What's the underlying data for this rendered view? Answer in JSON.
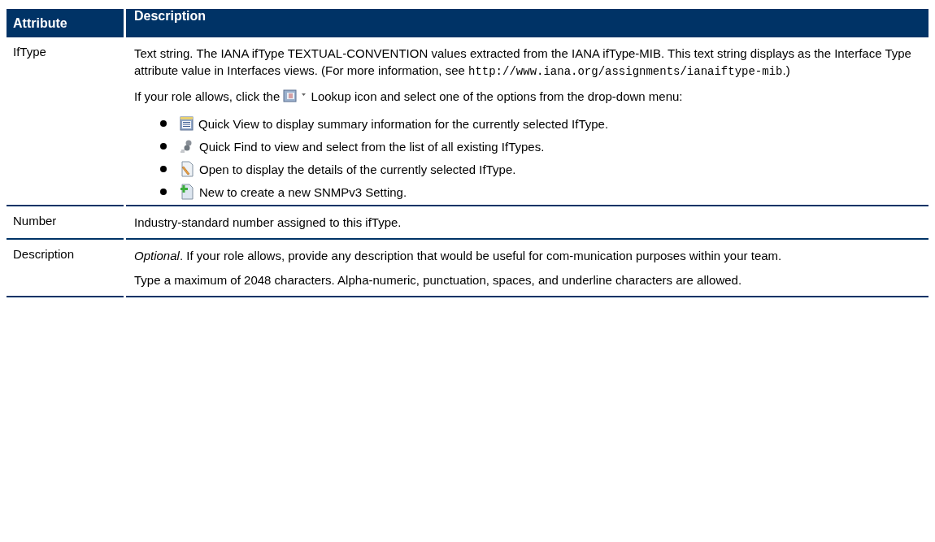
{
  "table": {
    "columns": [
      "Attribute",
      "Description"
    ],
    "rows": [
      {
        "attribute": "IfType",
        "content": [
          {
            "kind": "code_para",
            "before": "Text string. The IANA ifType TEXTUAL-CONVENTION values extracted from the IANA ifType-MIB. This text string displays as the Interface Type attribute value in Interfaces views. (For more information, see ",
            "code": "http://www.iana.org/assignments/ianaiftype-mib",
            "after": ".)"
          },
          {
            "kind": "icon_para",
            "before": "If your role allows, click the",
            "after": "Lookup icon and select one of the options from the drop-down menu:"
          },
          {
            "kind": "bullets",
            "items": [
              {
                "kind": "view",
                "text": "Quick View to display summary information for the currently selected IfType."
              },
              {
                "kind": "find",
                "text": "Quick Find to view and select from the list of all existing IfTypes."
              },
              {
                "kind": "open",
                "text": "Open to display the details of the currently selected IfType."
              },
              {
                "kind": "new",
                "text": "New to create a new SNMPv3 Setting."
              }
            ]
          }
        ]
      },
      {
        "attribute": "Number",
        "content": [
          {
            "kind": "text",
            "text": "Industry-standard number assigned to this ifType."
          }
        ]
      },
      {
        "attribute": "Description",
        "content": [
          {
            "kind": "text",
            "text": "*Optional*. If your role allows, provide any description that would be useful for com-munication purposes within your team."
          },
          {
            "kind": "text",
            "text": "Type a maximum of 2048 characters. Alpha-numeric, punctuation, spaces, and underline characters are allowed."
          }
        ]
      }
    ]
  }
}
